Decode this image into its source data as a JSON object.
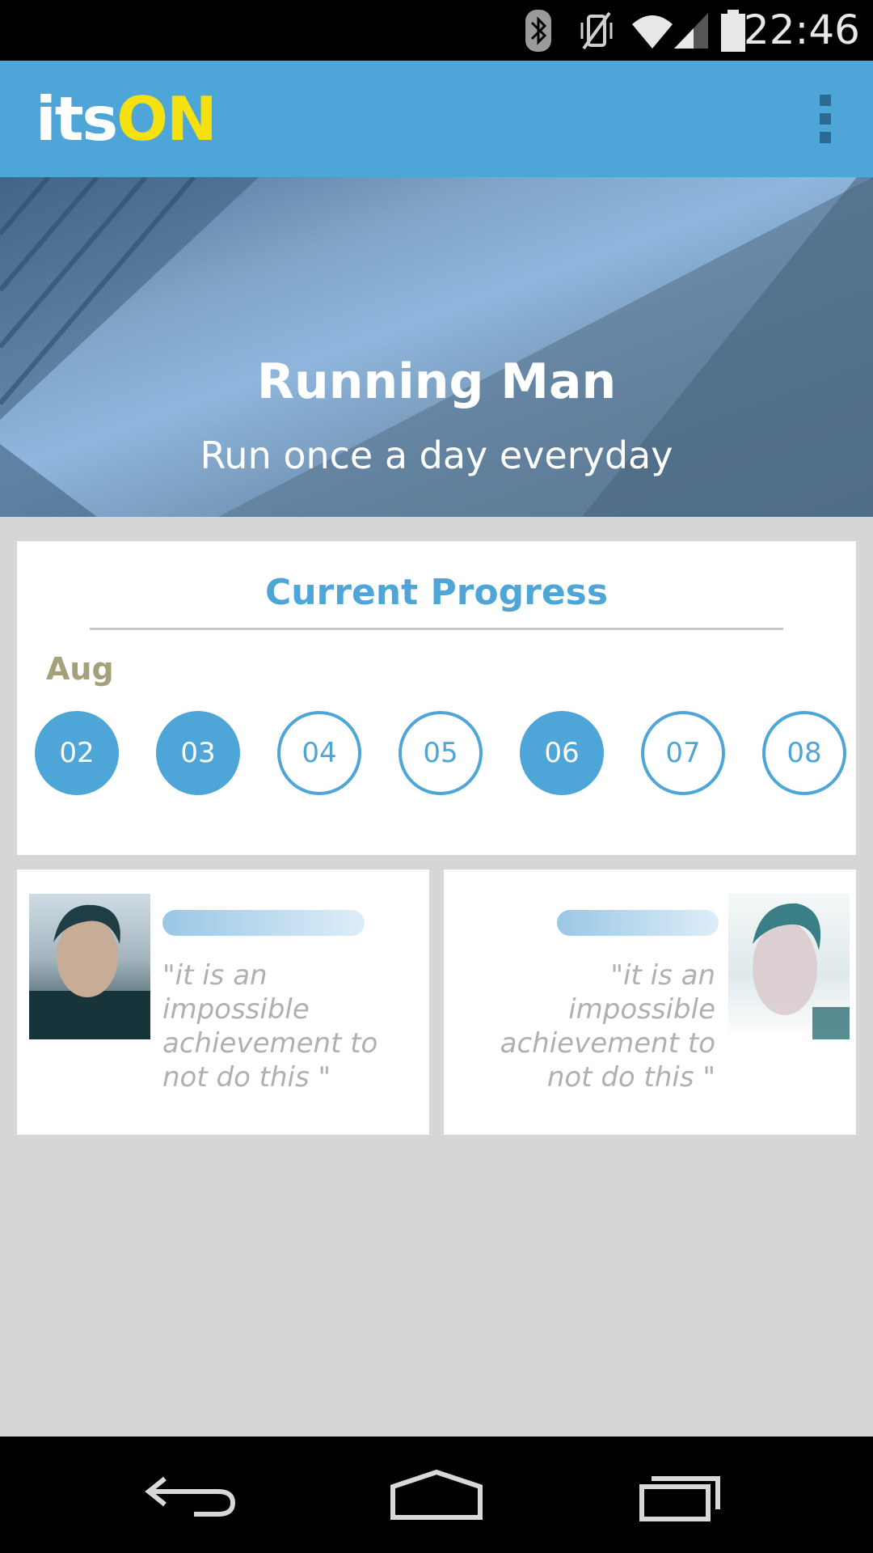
{
  "status_bar": {
    "time": "22:46",
    "icons": [
      "bluetooth-icon",
      "vibrate-mute-icon",
      "wifi-icon",
      "signal-icon",
      "battery-icon"
    ]
  },
  "app_bar": {
    "logo_part_a": "its",
    "logo_part_b": "ON",
    "menu_icon": "overflow-menu-icon"
  },
  "colors": {
    "accent": "#4ea6d8",
    "logo_yellow": "#f4e10f",
    "month_label": "#a4a07a",
    "quote_text": "#b0b0b0",
    "background": "#d6d6d6"
  },
  "hero": {
    "title": "Running Man",
    "subtitle": "Run once a day everyday"
  },
  "progress": {
    "title": "Current Progress",
    "month": "Aug",
    "days": [
      {
        "label": "02",
        "done": true
      },
      {
        "label": "03",
        "done": true
      },
      {
        "label": "04",
        "done": false
      },
      {
        "label": "05",
        "done": false
      },
      {
        "label": "06",
        "done": true
      },
      {
        "label": "07",
        "done": false
      },
      {
        "label": "08",
        "done": false
      }
    ]
  },
  "members": [
    {
      "quote": "\"it is an impossible achievement to not do this \""
    },
    {
      "quote": "\"it is an impossible achievement to not do this \""
    }
  ],
  "nav_bar": {
    "icons": [
      "back-icon",
      "home-icon",
      "recent-apps-icon"
    ]
  }
}
